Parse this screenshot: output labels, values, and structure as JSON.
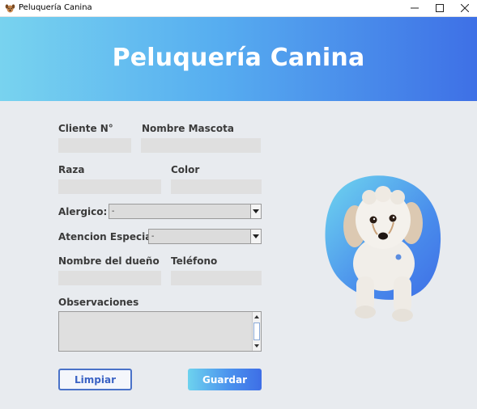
{
  "window": {
    "title": "Peluquería Canina",
    "icon": "dog-paw-icon"
  },
  "banner": {
    "title": "Peluquería Canina"
  },
  "form": {
    "cliente_label": "Cliente N°",
    "cliente_value": "",
    "mascota_label": "Nombre Mascota",
    "mascota_value": "",
    "raza_label": "Raza",
    "raza_value": "",
    "color_label": "Color",
    "color_value": "",
    "alergico_label": "Alergico:",
    "alergico_value": "-",
    "atencion_label": "Atencion Especial",
    "atencion_value": "-",
    "dueno_label": "Nombre del dueño",
    "dueno_value": "",
    "telefono_label": "Teléfono",
    "telefono_value": "",
    "observaciones_label": "Observaciones",
    "observaciones_value": ""
  },
  "buttons": {
    "clear_label": "Limpiar",
    "save_label": "Guardar"
  },
  "colors": {
    "banner_start": "#78d3ef",
    "banner_end": "#3e70e6",
    "accent": "#4a72c8"
  }
}
